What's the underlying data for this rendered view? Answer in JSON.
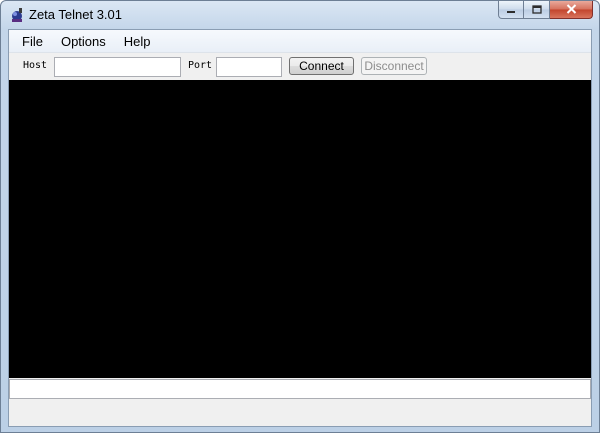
{
  "window": {
    "title": "Zeta Telnet 3.01",
    "icons": {
      "app": "telnet-app-icon",
      "minimize": "minimize-icon",
      "maximize": "maximize-icon",
      "close": "close-icon"
    }
  },
  "menu": {
    "items": [
      {
        "label": "File"
      },
      {
        "label": "Options"
      },
      {
        "label": "Help"
      }
    ]
  },
  "toolbar": {
    "host_label": "Host",
    "host_value": "",
    "port_label": "Port",
    "port_value": "",
    "connect_label": "Connect",
    "disconnect_label": "Disconnect",
    "disconnect_enabled": false
  },
  "terminal": {
    "background": "#000000"
  },
  "command_input": {
    "value": ""
  },
  "colors": {
    "close_button": "#c2442c",
    "chrome": "#c4d6ea"
  }
}
